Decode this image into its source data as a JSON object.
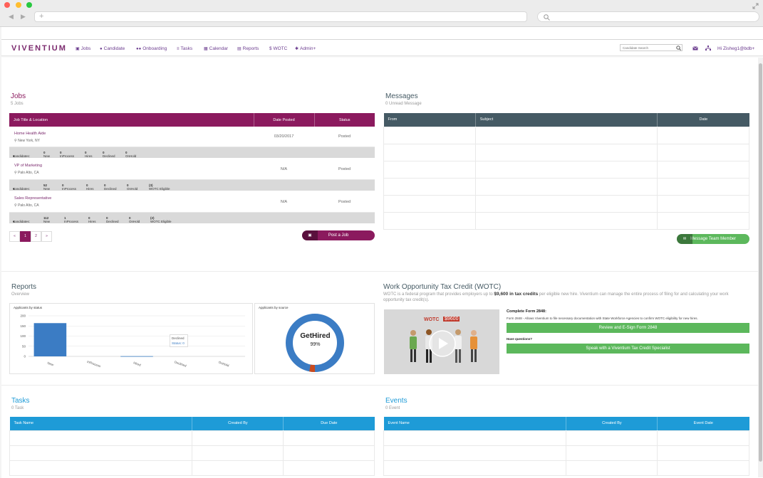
{
  "browser": {
    "back": "◀",
    "forward": "▶",
    "add": "+"
  },
  "nav": {
    "logo": "VIVENTIUM",
    "items": [
      "Jobs",
      "Candidate",
      "Onboarding",
      "Tasks",
      "Calendar",
      "Reports",
      "WOTC",
      "Admin"
    ],
    "wotc_prefix": "$",
    "admin_caret": "+",
    "search_placeholder": "Candidate Search",
    "user": "Hi Zisheg1@bdb"
  },
  "jobs": {
    "title": "Jobs",
    "subtitle": "5 Jobs",
    "headers": [
      "Job Title & Location",
      "Date Posted",
      "Status"
    ],
    "rows": [
      {
        "title": "Home Health Aide",
        "location": "New York, NY",
        "date": "03/20/2017",
        "status": "Posted",
        "cands": {
          "label": "Candidates:",
          "new": "New",
          "new_v": "0",
          "inproc": "InProcess",
          "inproc_v": "0",
          "hires": "Hires",
          "hires_v": "0",
          "declined": "Declined",
          "declined_v": "0",
          "onhold": "OnHold",
          "onhold_v": "0",
          "wotc": "",
          "wotc_v": ""
        }
      },
      {
        "title": "VP of Marketing",
        "location": "Palo Alto, CA",
        "date": "N/A",
        "status": "Posted",
        "cands": {
          "label": "Candidates:",
          "new": "New",
          "new_v": "52",
          "inproc": "InProcess",
          "inproc_v": "0",
          "hires": "Hires",
          "hires_v": "0",
          "declined": "Declined",
          "declined_v": "0",
          "onhold": "OnHold",
          "onhold_v": "0",
          "wotc": "WOTC Eligible",
          "wotc_v": "(3)"
        }
      },
      {
        "title": "Sales Representative",
        "location": "Palo Alto, CA",
        "date": "N/A",
        "status": "Posted",
        "cands": {
          "label": "Candidates:",
          "new": "New",
          "new_v": "112",
          "inproc": "InProcess",
          "inproc_v": "1",
          "hires": "Hires",
          "hires_v": "0",
          "declined": "Declined",
          "declined_v": "0",
          "onhold": "OnHold",
          "onhold_v": "0",
          "wotc": "WOTC Eligible",
          "wotc_v": "(2)"
        }
      }
    ],
    "pagination": [
      "«",
      "1",
      "2",
      "»"
    ],
    "post_button": "Post a Job"
  },
  "messages": {
    "title": "Messages",
    "subtitle": "0 Unread Message",
    "headers": [
      "From",
      "Subject",
      "Date"
    ],
    "button": "Message Team Member"
  },
  "reports": {
    "title": "Reports",
    "subtitle": "Overview",
    "bar_panel_title": "Applicants by status",
    "donut_panel_title": "Applicants by source",
    "tooltip_label": "Declined",
    "tooltip_value": "Status: 0",
    "donut_label": "GetHired",
    "donut_pct": "99%"
  },
  "chart_data": {
    "type": "bar",
    "categories": [
      "New",
      "InProcess",
      "Hired",
      "Declined",
      "OnHold"
    ],
    "values": [
      164,
      0,
      1,
      0,
      0
    ],
    "ylim": [
      0,
      200
    ],
    "yticks": [
      0,
      50,
      100,
      150,
      200
    ]
  },
  "wotc": {
    "title": "Work Opportunity Tax Credit (WOTC)",
    "desc_pre": "WOTC is a federal program that provides employers up to",
    "desc_bold": "$9,600 in tax credits",
    "desc_post": "per eligible new hire. Viventium can manage the entire process of filing for and calculating your work opportunity tax credit(s).",
    "video_badge": "WOTC",
    "video_amount": "$9600",
    "form_title": "Complete Form 2848:",
    "form_desc": "Form 2848 - Allows Viventium to file necessary documentation with State Workforce Agencies to confirm WOTC eligibility for new hires.",
    "form_button": "Review and E-Sign Form 2848",
    "questions": "Have questions?",
    "speak_button": "Speak with a Viventium Tax Credit Specialist"
  },
  "tasks": {
    "title": "Tasks",
    "subtitle": "0 Task",
    "headers": [
      "Task Name",
      "Created By",
      "Due Date"
    ]
  },
  "events": {
    "title": "Events",
    "subtitle": "0 Event",
    "headers": [
      "Event Name",
      "Created By",
      "Event Date"
    ]
  },
  "colors": {
    "jobs": "#8b1a5e",
    "messages": "#455a64",
    "blue": "#1e9bd7",
    "purple": "#7b2a6e",
    "green": "#5cb85c"
  }
}
